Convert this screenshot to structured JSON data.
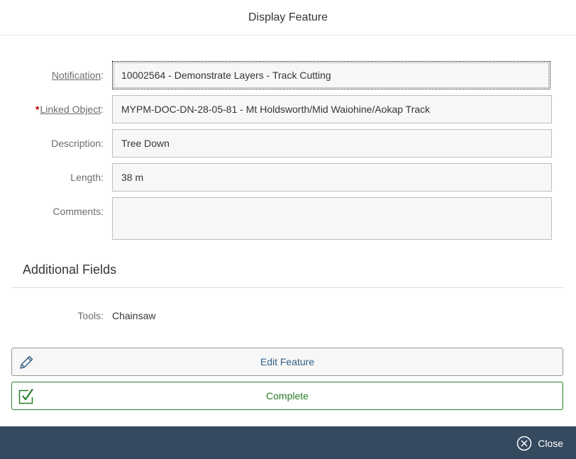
{
  "dialog": {
    "title": "Display Feature"
  },
  "form": {
    "notification": {
      "label": "Notification",
      "value": "10002564 - Demonstrate Layers - Track Cutting"
    },
    "linked_object": {
      "required_mark": "*",
      "label": "Linked Object",
      "value": "MYPM-DOC-DN-28-05-81 - Mt Holdsworth/Mid Waiohine/Aokap Track"
    },
    "description": {
      "label": "Description:",
      "value": "Tree Down"
    },
    "length": {
      "label": "Length:",
      "value": "38 m"
    },
    "comments": {
      "label": "Comments:",
      "value": ""
    }
  },
  "additional": {
    "title": "Additional Fields",
    "tools_label": "Tools:",
    "tools_value": "Chainsaw"
  },
  "actions": {
    "edit_label": "Edit Feature",
    "edit_icon": "pencil-icon",
    "complete_label": "Complete",
    "complete_icon": "checkbox-check-icon"
  },
  "footer": {
    "close_label": "Close",
    "close_icon": "close-circle-icon"
  },
  "colors": {
    "footer_bg": "#354a5f",
    "edit_text": "#346187",
    "complete_accent": "#2b7c2b",
    "required": "#bb0000"
  }
}
